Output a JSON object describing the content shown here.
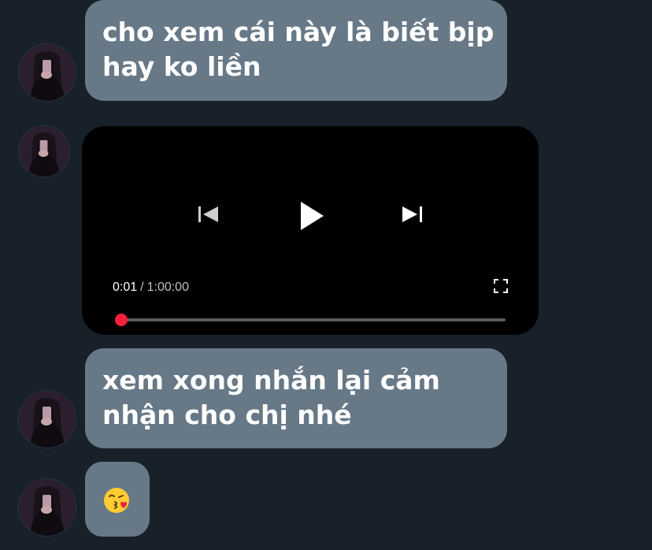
{
  "messages": [
    {
      "text_lines": [
        "cho xem cái này là biết bịp",
        "hay ko liền"
      ]
    },
    {
      "text_lines": [
        "xem xong nhắn lại cảm",
        "nhận cho chị nhé"
      ]
    }
  ],
  "video": {
    "current_time": "0:01",
    "separator": "/",
    "duration": "1:00:00",
    "progress_fraction": 0.0003,
    "progress_color": "#ff1f3a"
  },
  "emoji_message": {
    "icon": "face-blowing-kiss-emoji"
  },
  "colors": {
    "background": "#18202a",
    "bubble": "#677887",
    "video_bg": "#000000"
  }
}
